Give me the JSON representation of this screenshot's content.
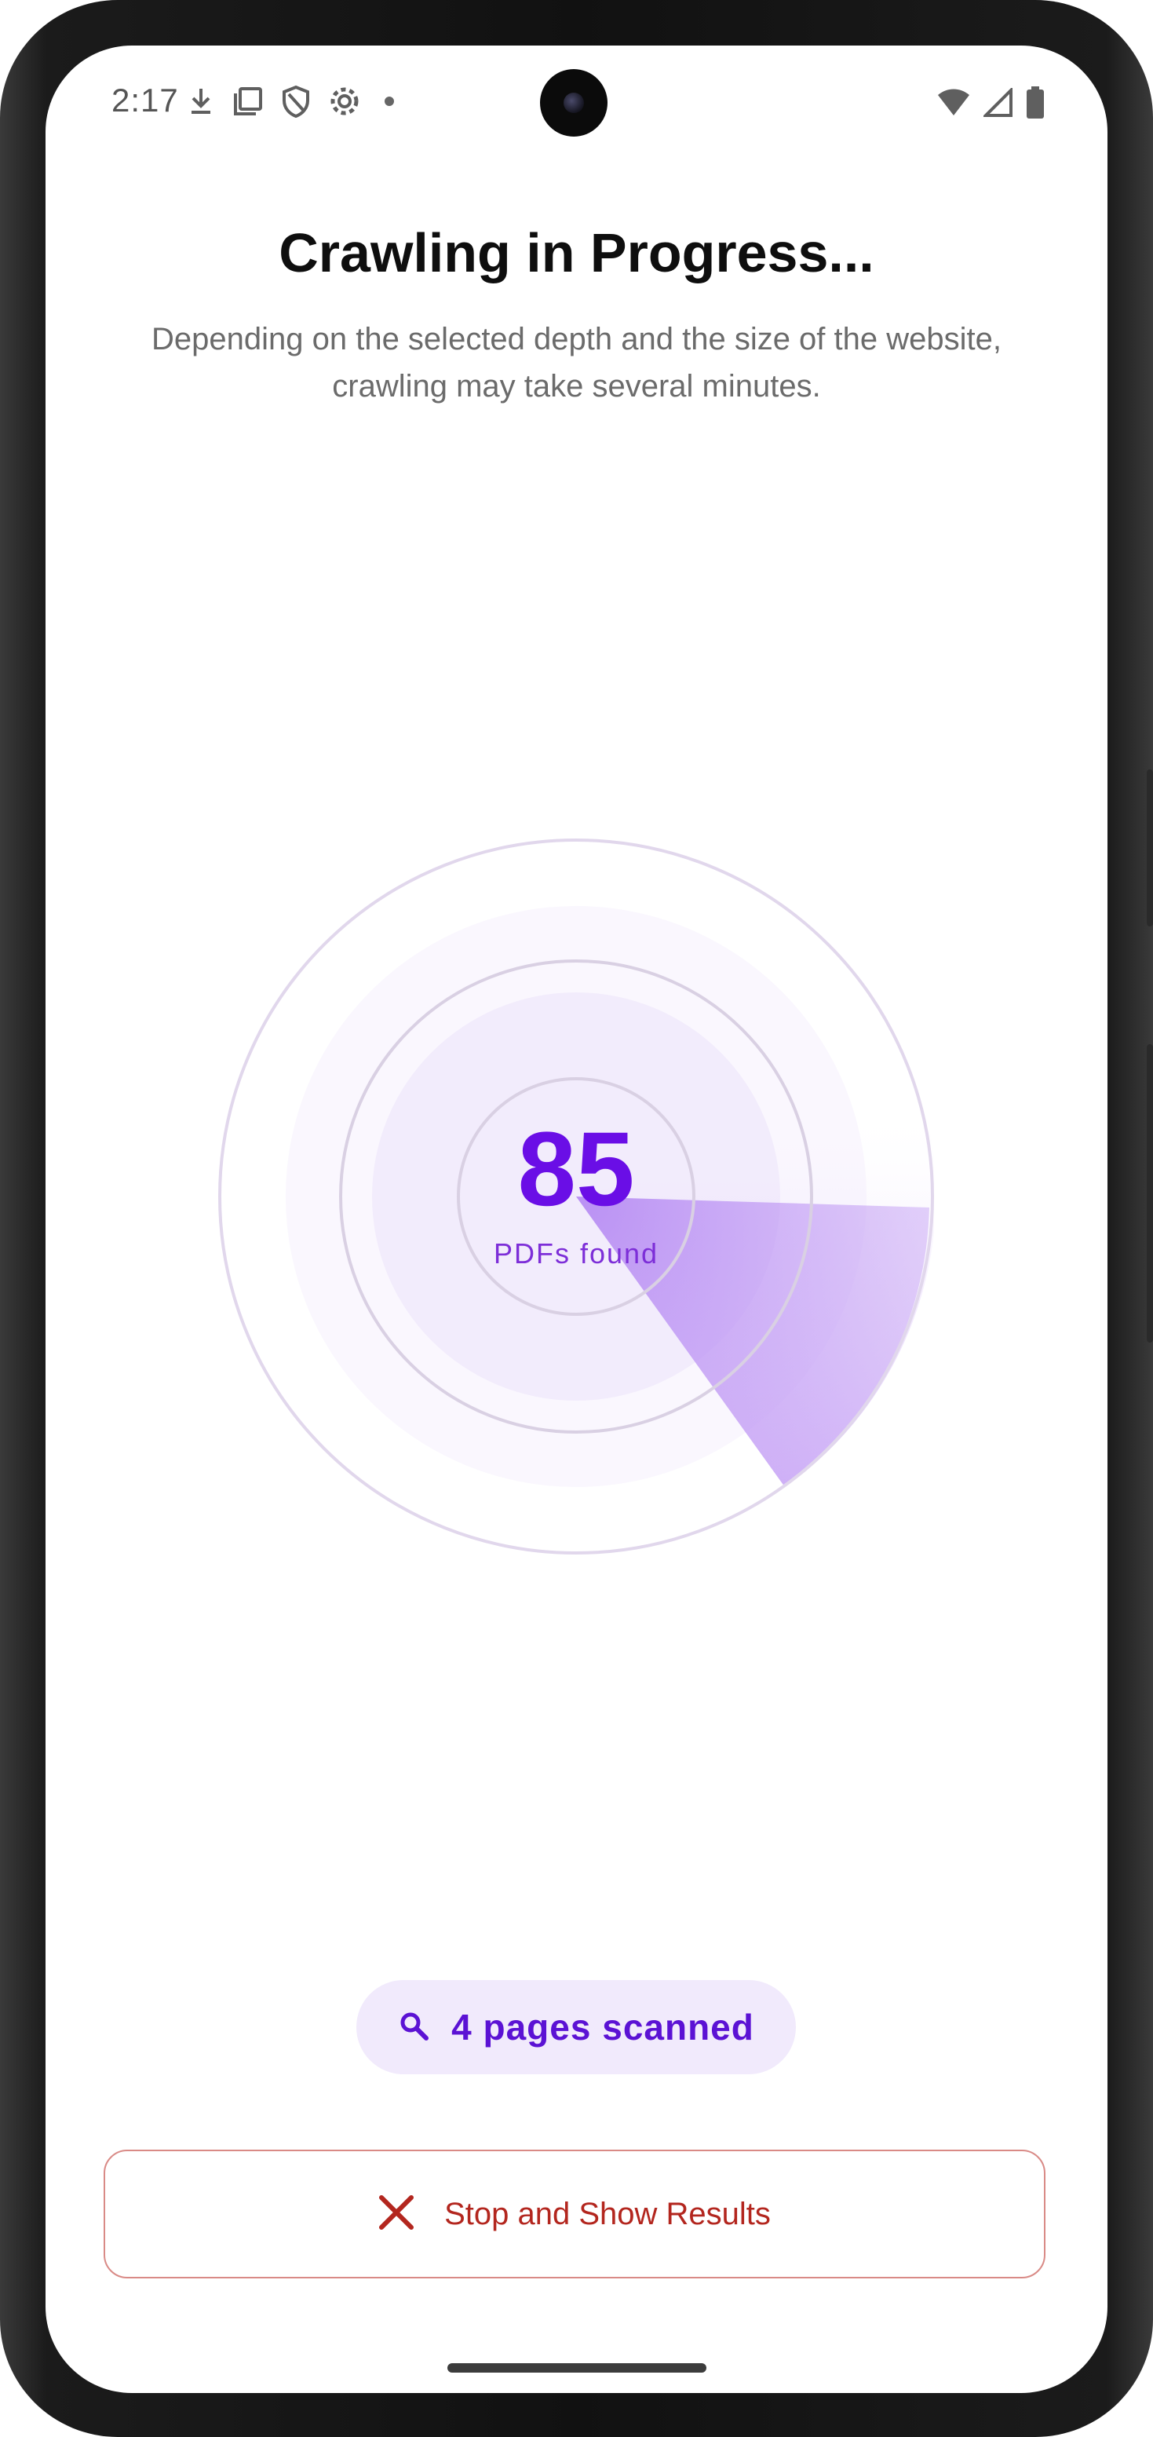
{
  "status_bar": {
    "time": "2:17",
    "left_icons": [
      "download-icon",
      "copy-icon",
      "shield-icon",
      "settings-icon",
      "dot-icon"
    ],
    "right_icons": [
      "wifi-icon",
      "signal-icon",
      "battery-icon"
    ]
  },
  "header": {
    "title": "Crawling in Progress...",
    "subtitle": "Depending on the selected depth and the size of the website, crawling may take several minutes."
  },
  "radar": {
    "count": "85",
    "count_label": "PDFs found",
    "accent_color": "#6a0ee6"
  },
  "pages_chip": {
    "icon": "search-icon",
    "label": "4 pages scanned"
  },
  "stop_button": {
    "icon": "close-icon",
    "label": "Stop and Show Results",
    "color": "#b3261e"
  }
}
